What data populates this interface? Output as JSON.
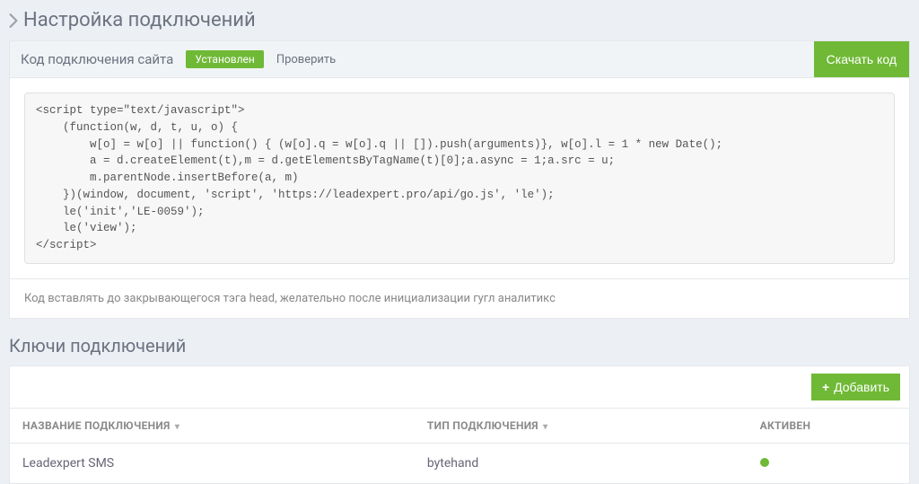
{
  "page": {
    "title": "Настройка подключений"
  },
  "codePanel": {
    "title": "Код подключения сайта",
    "statusBadge": "Установлен",
    "checkLabel": "Проверить",
    "downloadLabel": "Скачать код",
    "code": "<script type=\"text/javascript\">\n    (function(w, d, t, u, o) {\n        w[o] = w[o] || function() { (w[o].q = w[o].q || []).push(arguments)}, w[o].l = 1 * new Date();\n        a = d.createElement(t),m = d.getElementsByTagName(t)[0];a.async = 1;a.src = u;\n        m.parentNode.insertBefore(a, m)\n    })(window, document, 'script', 'https://leadexpert.pro/api/go.js', 'le');\n    le('init','LE-0059');\n    le('view');\n</script>",
    "footerNote": "Код вставлять до закрывающегося тэга head, желательно после инициализации гугл аналитикс"
  },
  "keys": {
    "sectionTitle": "Ключи подключений",
    "addLabel": "Добавить",
    "columns": {
      "name": "НАЗВАНИЕ ПОДКЛЮЧЕНИЯ",
      "type": "ТИП ПОДКЛЮЧЕНИЯ",
      "active": "АКТИВЕН"
    },
    "rows": [
      {
        "name": "Leadexpert SMS",
        "type": "bytehand",
        "active": true
      }
    ]
  }
}
